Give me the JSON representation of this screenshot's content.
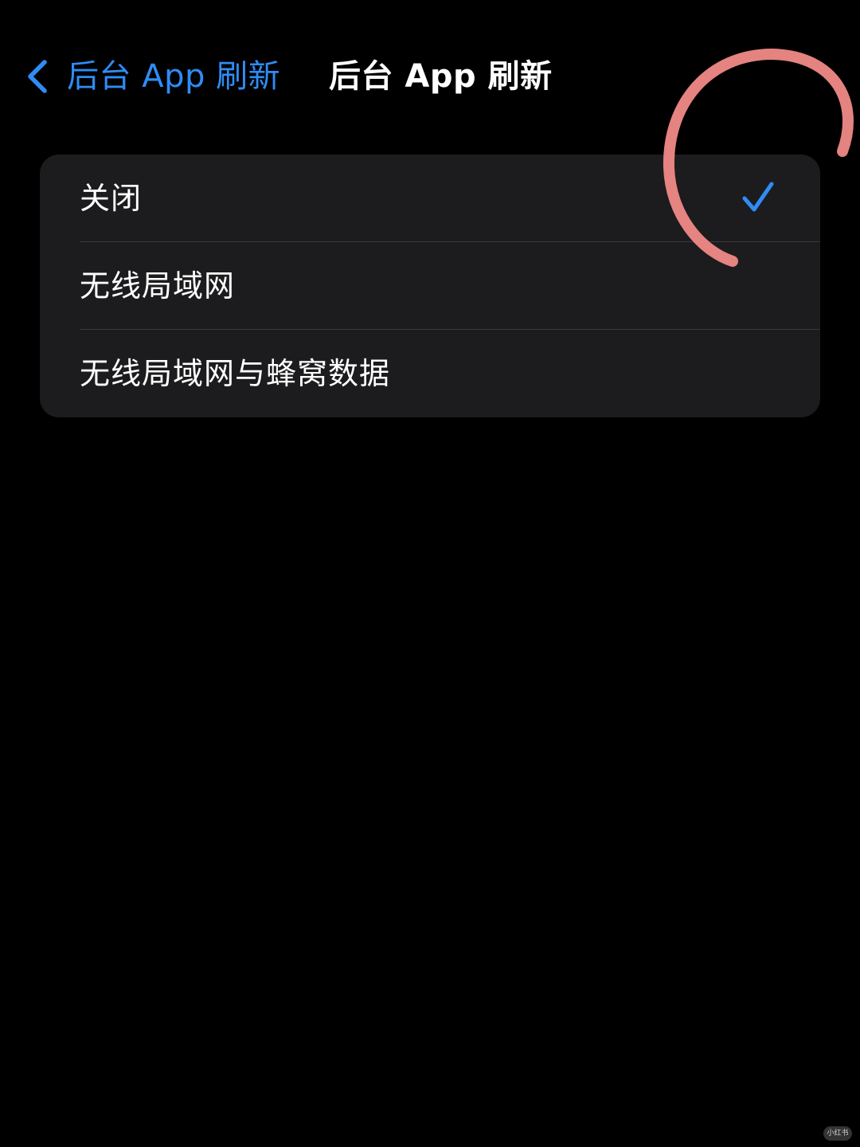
{
  "nav": {
    "back_label": "后台 App 刷新",
    "title": "后台 App 刷新"
  },
  "options": [
    {
      "label": "关闭",
      "selected": true
    },
    {
      "label": "无线局域网",
      "selected": false
    },
    {
      "label": "无线局域网与蜂窝数据",
      "selected": false
    }
  ],
  "watermark": "小红书",
  "colors": {
    "background": "#000000",
    "card": "#1c1c1e",
    "accent": "#2f8cf6",
    "annotation": "#f08a86",
    "text": "#ffffff"
  },
  "icons": {
    "back": "chevron-left-icon",
    "selected": "checkmark-icon"
  }
}
